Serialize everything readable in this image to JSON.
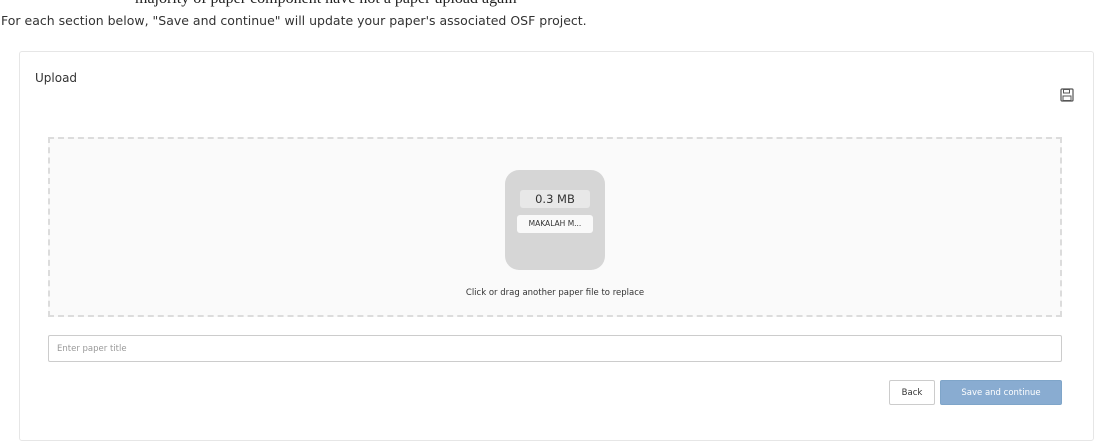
{
  "top_clipped_text": "majority of paper component have not a paper upload again",
  "intro": "For each section below, \"Save and continue\" will update your paper's associated OSF project.",
  "panel": {
    "title": "Upload",
    "save_icon": "floppy-disk-icon"
  },
  "upload": {
    "file_size": "0.3 MB",
    "file_name": "MAKALAH M...",
    "replace_text": "Click or drag another paper file to replace"
  },
  "title_input": {
    "placeholder": "Enter paper title",
    "value": ""
  },
  "buttons": {
    "back": "Back",
    "save_continue": "Save and continue"
  },
  "colors": {
    "primary_button": "#89acd1",
    "tile": "#d6d6d6",
    "dashed_border": "#dcdcdc"
  }
}
